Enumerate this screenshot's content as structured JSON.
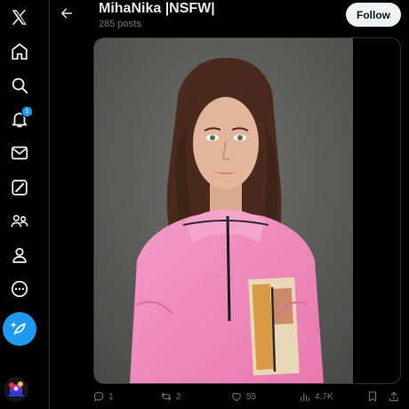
{
  "nav": {
    "items": [
      {
        "name": "x-logo-icon"
      },
      {
        "name": "home-icon"
      },
      {
        "name": "explore-icon"
      },
      {
        "name": "notifications-icon",
        "badge": "1"
      },
      {
        "name": "messages-icon"
      },
      {
        "name": "grok-icon"
      },
      {
        "name": "communities-icon"
      },
      {
        "name": "profile-icon"
      },
      {
        "name": "more-icon"
      }
    ],
    "compose_icon": "post-compose-icon"
  },
  "header": {
    "title": "MihaNika |NSFW|",
    "subtitle": "285 posts",
    "follow_label": "Follow"
  },
  "post": {
    "actions": {
      "replies": "1",
      "reposts": "2",
      "likes": "55",
      "views": "4.7K"
    }
  },
  "colors": {
    "background": "#000000",
    "accent": "#1d9bf0",
    "text_primary": "#e7e9ea",
    "text_secondary": "#71767b",
    "follow_bg": "#eff3f4",
    "sweater_pink": "#f08bbd"
  }
}
